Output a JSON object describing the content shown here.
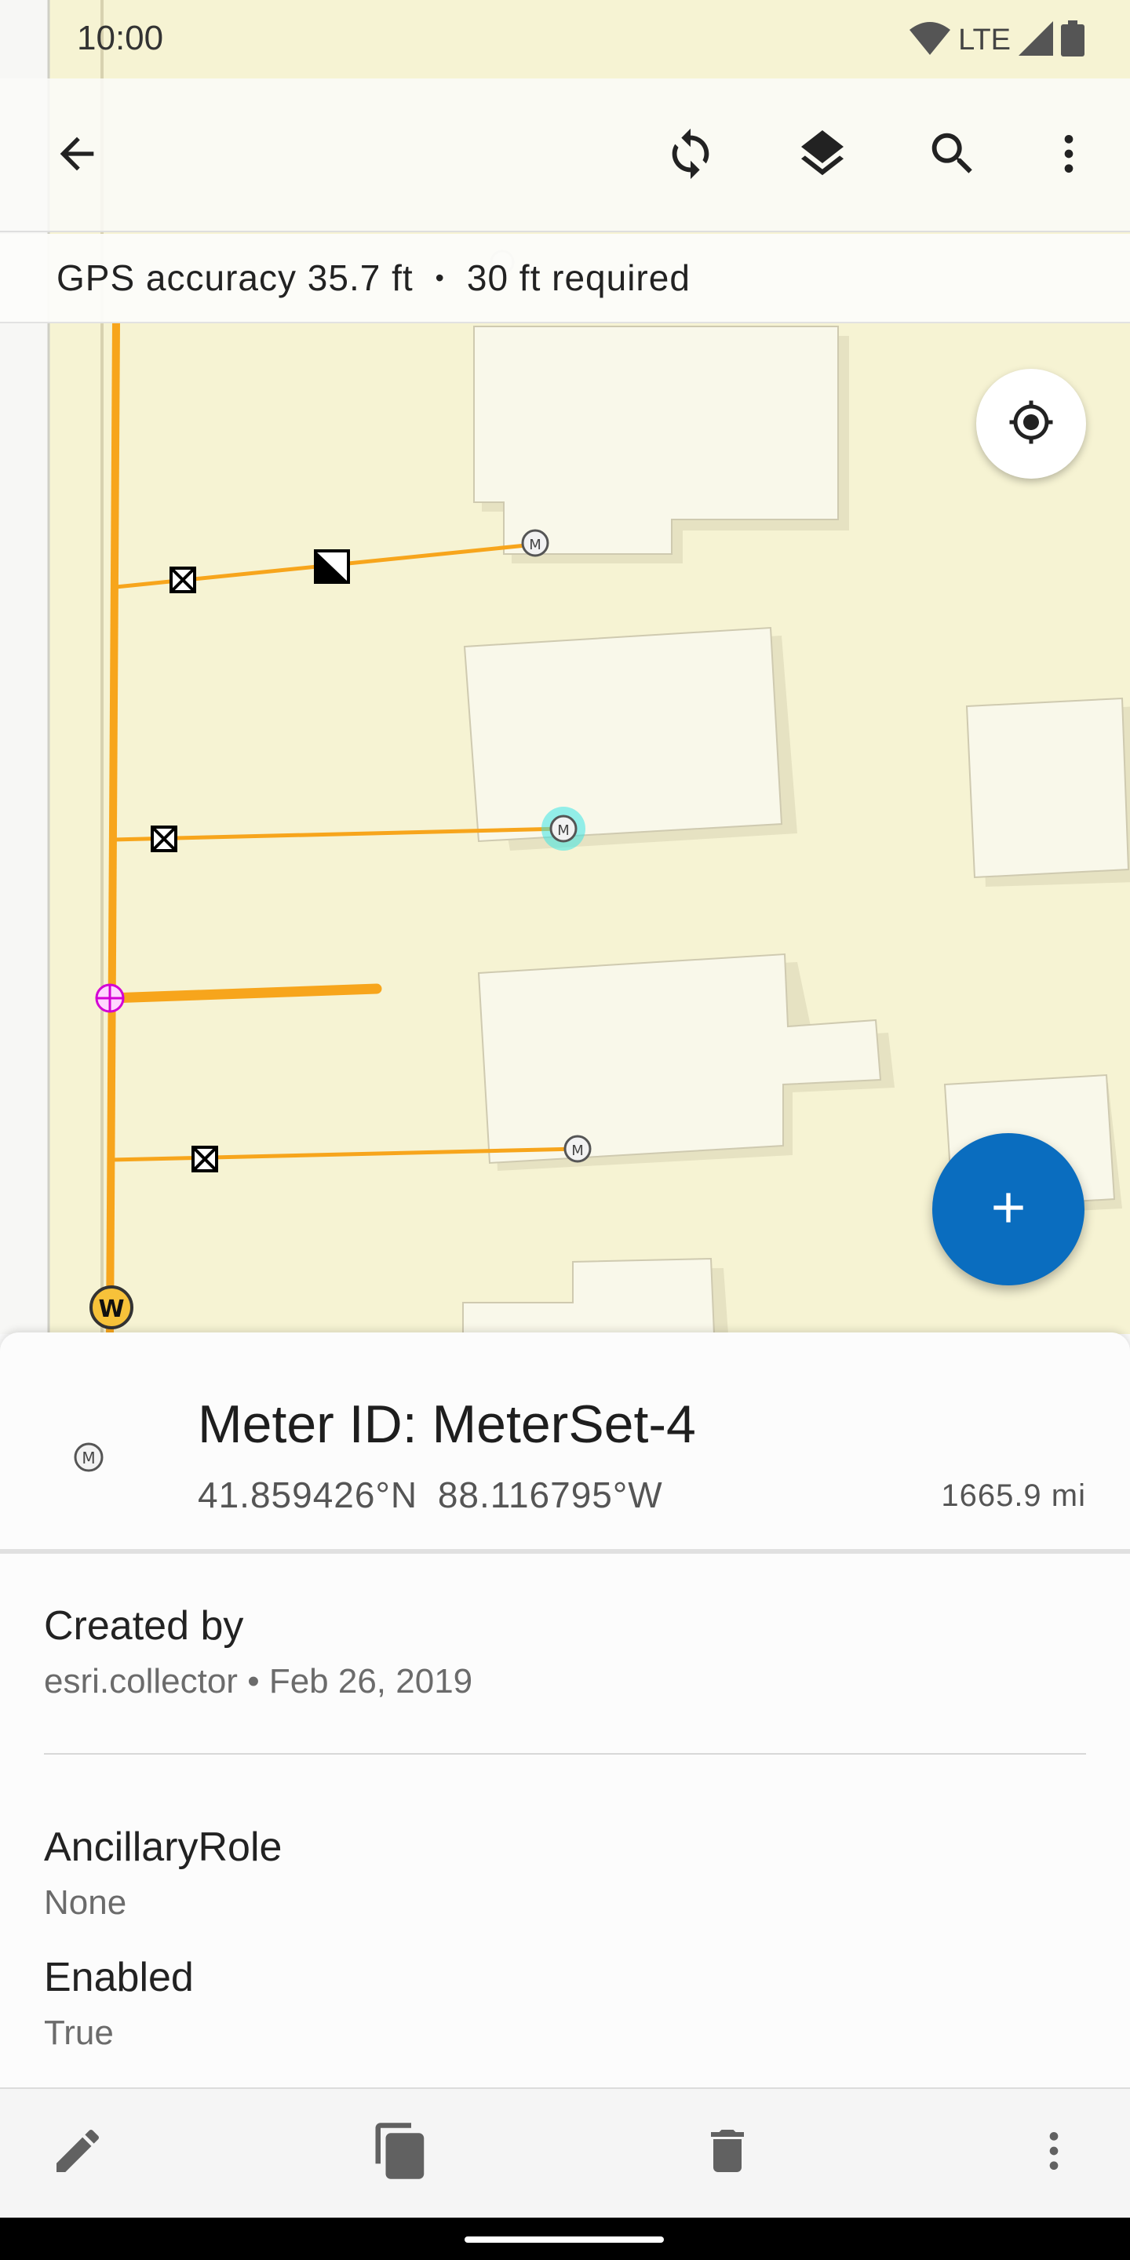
{
  "status_bar": {
    "time": "10:00",
    "network": "LTE"
  },
  "toolbar": {
    "back": "back-icon",
    "sync": "sync-icon",
    "layers": "layers-icon",
    "search": "search-icon",
    "overflow": "more-vert-icon"
  },
  "gps": {
    "accuracy": "GPS accuracy 35.7 ft",
    "separator": "•",
    "required": "30 ft required"
  },
  "map": {
    "land_color": "#f6f3d3",
    "line_color": "#f7a51c",
    "selected_highlight": "#3ee6e6",
    "fab_color": "#0a6dbf"
  },
  "feature": {
    "title": "Meter ID: MeterSet-4",
    "coords": "41.859426°N  88.116795°W",
    "distance": "1665.9 mi"
  },
  "attributes": [
    {
      "label": "Created by",
      "value": "esri.collector • Feb 26, 2019"
    },
    {
      "label": "AncillaryRole",
      "value": "None"
    },
    {
      "label": "Enabled",
      "value": "True"
    }
  ],
  "bottom_bar": {
    "edit": "edit-icon",
    "copy": "copy-icon",
    "delete": "delete-icon",
    "more": "more-vert-icon"
  }
}
